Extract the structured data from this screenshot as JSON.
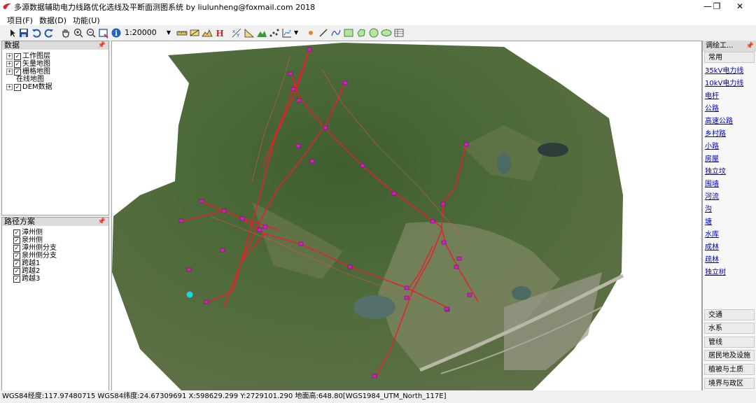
{
  "window": {
    "title": "多源数据辅助电力线路优化选线及平断面测图系统 by liulunheng@foxmail.com 2018",
    "controls": [
      "—",
      "❐",
      "✕"
    ]
  },
  "menu": [
    {
      "label": "项目(F)"
    },
    {
      "label": "数据(D)"
    },
    {
      "label": "功能(U)"
    }
  ],
  "toolbar": {
    "scale": "1:20000",
    "icons": [
      "pointer-icon",
      "save-icon",
      "undo-icon",
      "redo-icon",
      "pan-hand-icon",
      "zoom-in-icon",
      "zoom-out-icon",
      "full-extent-icon",
      "info-icon",
      "measure-ruler-icon",
      "measure-area-icon",
      "profile-icon",
      "section-icon",
      "xy-coordinate-icon",
      "slope-icon",
      "terrain-icon",
      "points-icon",
      "chart-icon",
      "dot-icon",
      "line-icon",
      "curve-icon",
      "rectangle-icon",
      "polygon-icon",
      "circle-icon",
      "ellipse-icon",
      "table-icon"
    ]
  },
  "data_panel": {
    "title": "数据",
    "items": [
      {
        "label": "工作图层",
        "expander": "+",
        "checked": true
      },
      {
        "label": "矢量地图",
        "expander": "+",
        "checked": true
      },
      {
        "label": "栅格地图",
        "expander": "+",
        "checked": true
      },
      {
        "label": "在线地图",
        "expander": "",
        "checked": null
      },
      {
        "label": "DEM数据",
        "expander": "+",
        "checked": true
      }
    ]
  },
  "route_panel": {
    "title": "路径方案",
    "items": [
      {
        "label": "漳州侧",
        "checked": true
      },
      {
        "label": "泉州侧",
        "checked": true
      },
      {
        "label": "漳州侧分支",
        "checked": true
      },
      {
        "label": "泉州侧分支",
        "checked": true
      },
      {
        "label": "跨越1",
        "checked": true
      },
      {
        "label": "跨越2",
        "checked": true
      },
      {
        "label": "跨越3",
        "checked": true
      }
    ]
  },
  "right_panel": {
    "title": "调绘工...",
    "active_tab": "常用",
    "links": [
      "35kV电力线",
      "10kV电力线",
      "电杆",
      "公路",
      "高速公路",
      "乡村路",
      "小路",
      "房屋",
      "独立坟",
      "围墙",
      "河流",
      "沟",
      "塘",
      "水库",
      "成林",
      "疏林",
      "独立树"
    ],
    "bottom_tabs": [
      "交通",
      "水系",
      "管线",
      "居民地及设施",
      "植被与土质",
      "境界与政区"
    ]
  },
  "status": "WGS84经度:117.97480715 WGS84纬度:24.67309691 X:598629.299 Y:2729101.290 地面高:648.80[WGS1984_UTM_North_117E]",
  "colors": {
    "route": "#e8202a",
    "tower": "#d020c0",
    "marker": "#19d6e6"
  }
}
